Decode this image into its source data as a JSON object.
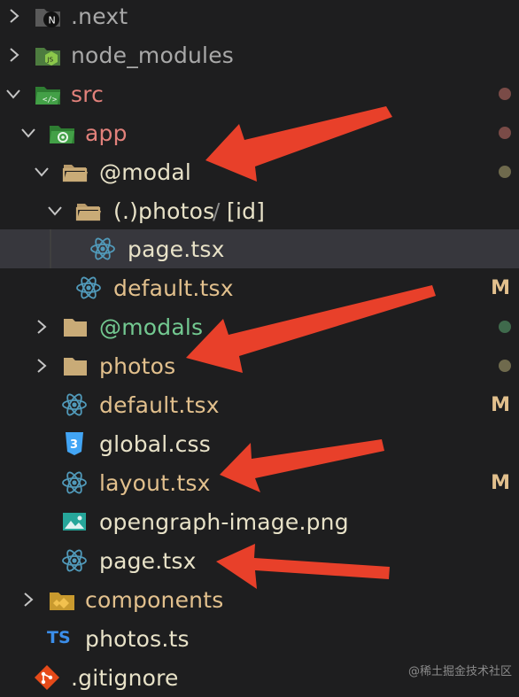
{
  "tree": {
    "items": [
      {
        "label": ".next",
        "color": "#a8a8a8",
        "icon": "next-folder-icon",
        "status": ""
      },
      {
        "label": "node_modules",
        "color": "#a8a8a8",
        "icon": "node-folder-icon",
        "status": ""
      },
      {
        "label": "src",
        "color": "#e2817b",
        "icon": "src-folder-icon",
        "status": "dot",
        "status_color": "#7a4b47"
      },
      {
        "label": "app",
        "color": "#e2817b",
        "icon": "app-folder-icon",
        "status": "dot",
        "status_color": "#7a4b47"
      },
      {
        "label": "@modal",
        "color": "#e8e2c8",
        "icon": "folder-open-icon",
        "status": "dot",
        "status_color": "#6f6a4d"
      },
      {
        "label": "(.)photos",
        "sep": "/",
        "label2": "[id]",
        "color": "#e8e2c8",
        "icon": "folder-open-icon",
        "status": ""
      },
      {
        "label": "page.tsx",
        "color": "#e8e2c8",
        "icon": "react-icon",
        "status": ""
      },
      {
        "label": "default.tsx",
        "color": "#e2c08d",
        "icon": "react-icon",
        "status": "M",
        "status_color": "#e2c08d"
      },
      {
        "label": "@modals",
        "color": "#73c991",
        "icon": "folder-icon",
        "status": "dot",
        "status_color": "#3f6a4c"
      },
      {
        "label": "photos",
        "color": "#e2c08d",
        "icon": "folder-icon",
        "status": "dot",
        "status_color": "#6f6a4d"
      },
      {
        "label": "default.tsx",
        "color": "#e2c08d",
        "icon": "react-icon",
        "status": "M",
        "status_color": "#e2c08d"
      },
      {
        "label": "global.css",
        "color": "#e8e2c8",
        "icon": "css-icon",
        "status": ""
      },
      {
        "label": "layout.tsx",
        "color": "#e2c08d",
        "icon": "react-icon",
        "status": "M",
        "status_color": "#e2c08d"
      },
      {
        "label": "opengraph-image.png",
        "color": "#e8e2c8",
        "icon": "image-icon",
        "status": ""
      },
      {
        "label": "page.tsx",
        "color": "#e8e2c8",
        "icon": "react-icon",
        "status": ""
      },
      {
        "label": "components",
        "color": "#e2c08d",
        "icon": "components-folder-icon",
        "status": ""
      },
      {
        "label": "photos.ts",
        "color": "#e8e2c8",
        "icon": "ts-icon",
        "status": ""
      },
      {
        "label": ".gitignore",
        "color": "#e8e2c8",
        "icon": "git-icon",
        "status": ""
      }
    ]
  },
  "ts_badge": "TS",
  "watermark": "@稀土掘金技术社区",
  "colors": {
    "arrow": "#e8402a",
    "background": "#1e1e1f",
    "selected": "#37373d"
  }
}
